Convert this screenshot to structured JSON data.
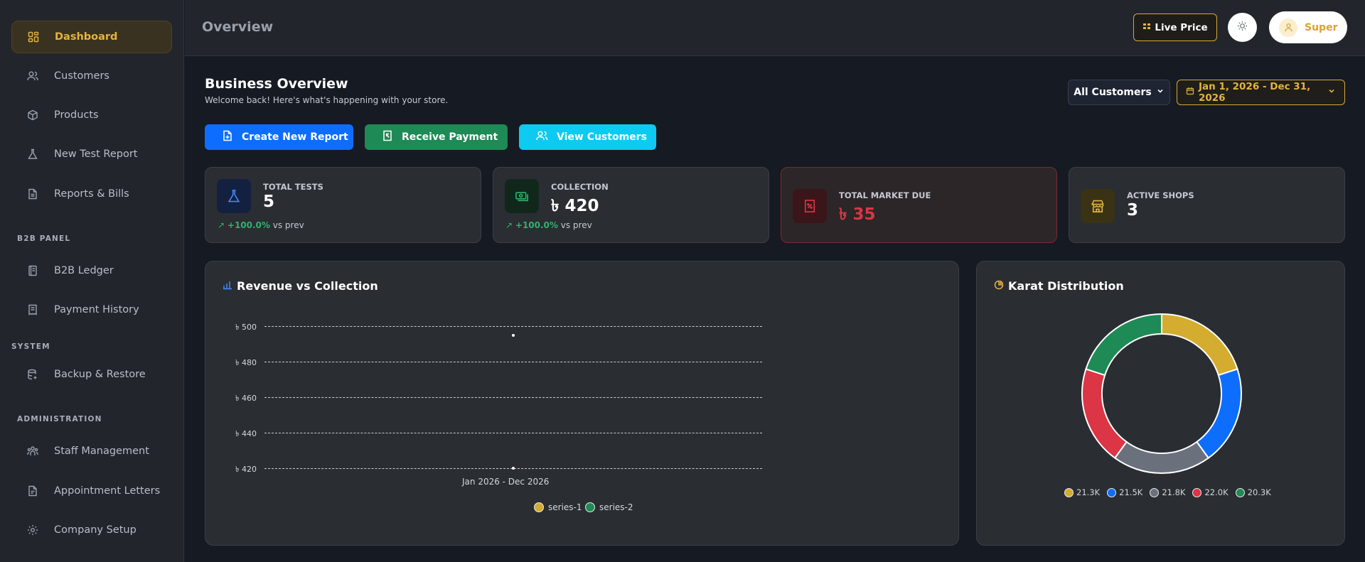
{
  "sidebar": {
    "items": [
      {
        "label": "Dashboard",
        "icon": "dashboard-icon"
      },
      {
        "label": "Customers",
        "icon": "users-icon"
      },
      {
        "label": "Products",
        "icon": "box-icon"
      },
      {
        "label": "New Test Report",
        "icon": "flask-icon"
      },
      {
        "label": "Reports & Bills",
        "icon": "file-icon"
      }
    ],
    "section_b2b": "B2B PANEL",
    "b2b_items": [
      {
        "label": "B2B Ledger",
        "icon": "ledger-icon"
      },
      {
        "label": "Payment History",
        "icon": "receipt-icon"
      }
    ],
    "section_system": "SYSTEM",
    "system_items": [
      {
        "label": "Backup & Restore",
        "icon": "database-icon"
      }
    ],
    "section_admin": "ADMINISTRATION",
    "admin_items": [
      {
        "label": "Staff Management",
        "icon": "team-icon"
      },
      {
        "label": "Appointment Letters",
        "icon": "document-icon"
      },
      {
        "label": "Company Setup",
        "icon": "gear-icon"
      }
    ]
  },
  "topbar": {
    "title": "Overview",
    "live_price_label": "Live Price",
    "user_label": "Super"
  },
  "header": {
    "title": "Business Overview",
    "subtitle": "Welcome back! Here's what's happening with your store.",
    "customers_filter": "All Customers",
    "date_range": "Jan 1, 2026 - Dec 31, 2026"
  },
  "actions": {
    "create_report": "Create New Report",
    "receive_payment": "Receive Payment",
    "view_customers": "View Customers"
  },
  "stats": [
    {
      "label": "TOTAL TESTS",
      "value": "5",
      "trend_pct": "+100.0%",
      "trend_suffix": "vs prev",
      "color": "#0d6efd"
    },
    {
      "label": "COLLECTION",
      "value": "৳ 420",
      "trend_pct": "+100.0%",
      "trend_suffix": "vs prev",
      "color": "#2fb36b"
    },
    {
      "label": "TOTAL MARKET DUE",
      "value": "৳ 35",
      "color": "#dc3545"
    },
    {
      "label": "ACTIVE SHOPS",
      "value": "3",
      "color": "#e3b43d"
    }
  ],
  "revenue_panel": {
    "title": "Revenue vs Collection"
  },
  "karat_panel": {
    "title": "Karat Distribution"
  },
  "chart_data": [
    {
      "type": "line",
      "title": "Revenue vs Collection",
      "categories": [
        "Jan 2026 - Dec 2026"
      ],
      "series": [
        {
          "name": "series-1",
          "values": [
            495
          ],
          "color": "#e3b43d"
        },
        {
          "name": "series-2",
          "values": [
            420
          ],
          "color": "#1e8a55"
        }
      ],
      "yticks": [
        "৳ 500",
        "৳ 480",
        "৳ 460",
        "৳ 440",
        "৳ 420"
      ],
      "ylim": [
        420,
        500
      ],
      "grid": true,
      "legend": "bottom"
    },
    {
      "type": "pie",
      "title": "Karat Distribution",
      "labels": [
        "21.3K",
        "21.5K",
        "21.8K",
        "22.0K",
        "20.3K"
      ],
      "values": [
        20,
        20,
        20,
        20,
        20
      ],
      "colors": [
        "#d4ac30",
        "#0d6efd",
        "#6b717c",
        "#dc3545",
        "#1e8a55"
      ],
      "legend": "bottom"
    }
  ]
}
